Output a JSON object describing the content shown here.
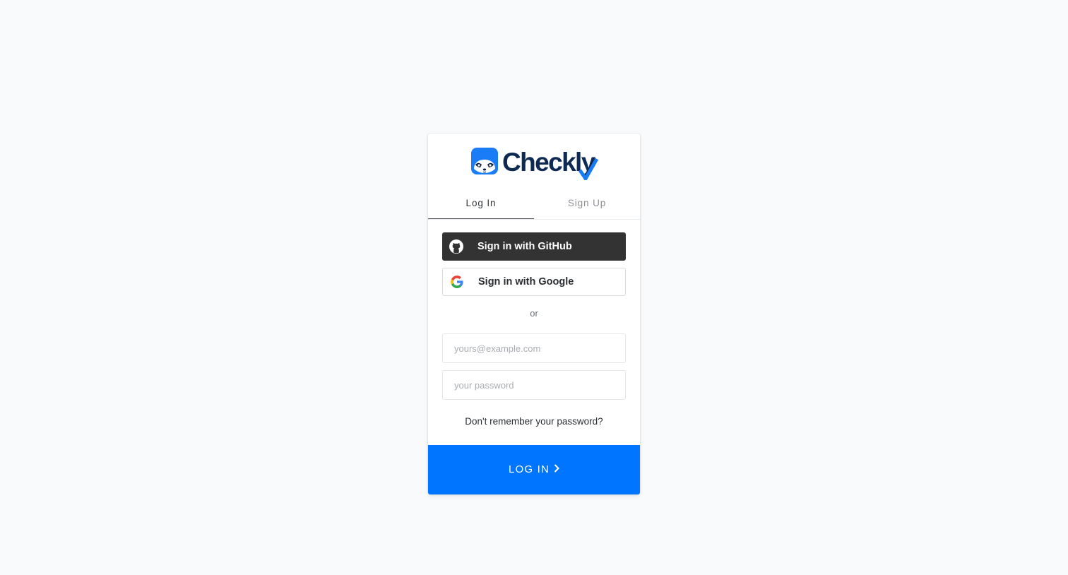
{
  "logo": {
    "text": "Checkly",
    "brand_color": "#0e2a52",
    "accent_color": "#0075ff"
  },
  "tabs": [
    {
      "label": "Log In",
      "active": true
    },
    {
      "label": "Sign Up",
      "active": false
    }
  ],
  "social": {
    "github_label": "Sign in with GitHub",
    "github_icon": "github-icon",
    "google_label": "Sign in with Google",
    "google_icon": "google-icon"
  },
  "divider_text": "or",
  "form": {
    "email_placeholder": "yours@example.com",
    "email_value": "",
    "password_placeholder": "your password",
    "password_value": ""
  },
  "forgot_password_label": "Don't remember your password?",
  "submit": {
    "label": "LOG IN",
    "icon": "chevron-right-icon",
    "color": "#0075ff"
  }
}
